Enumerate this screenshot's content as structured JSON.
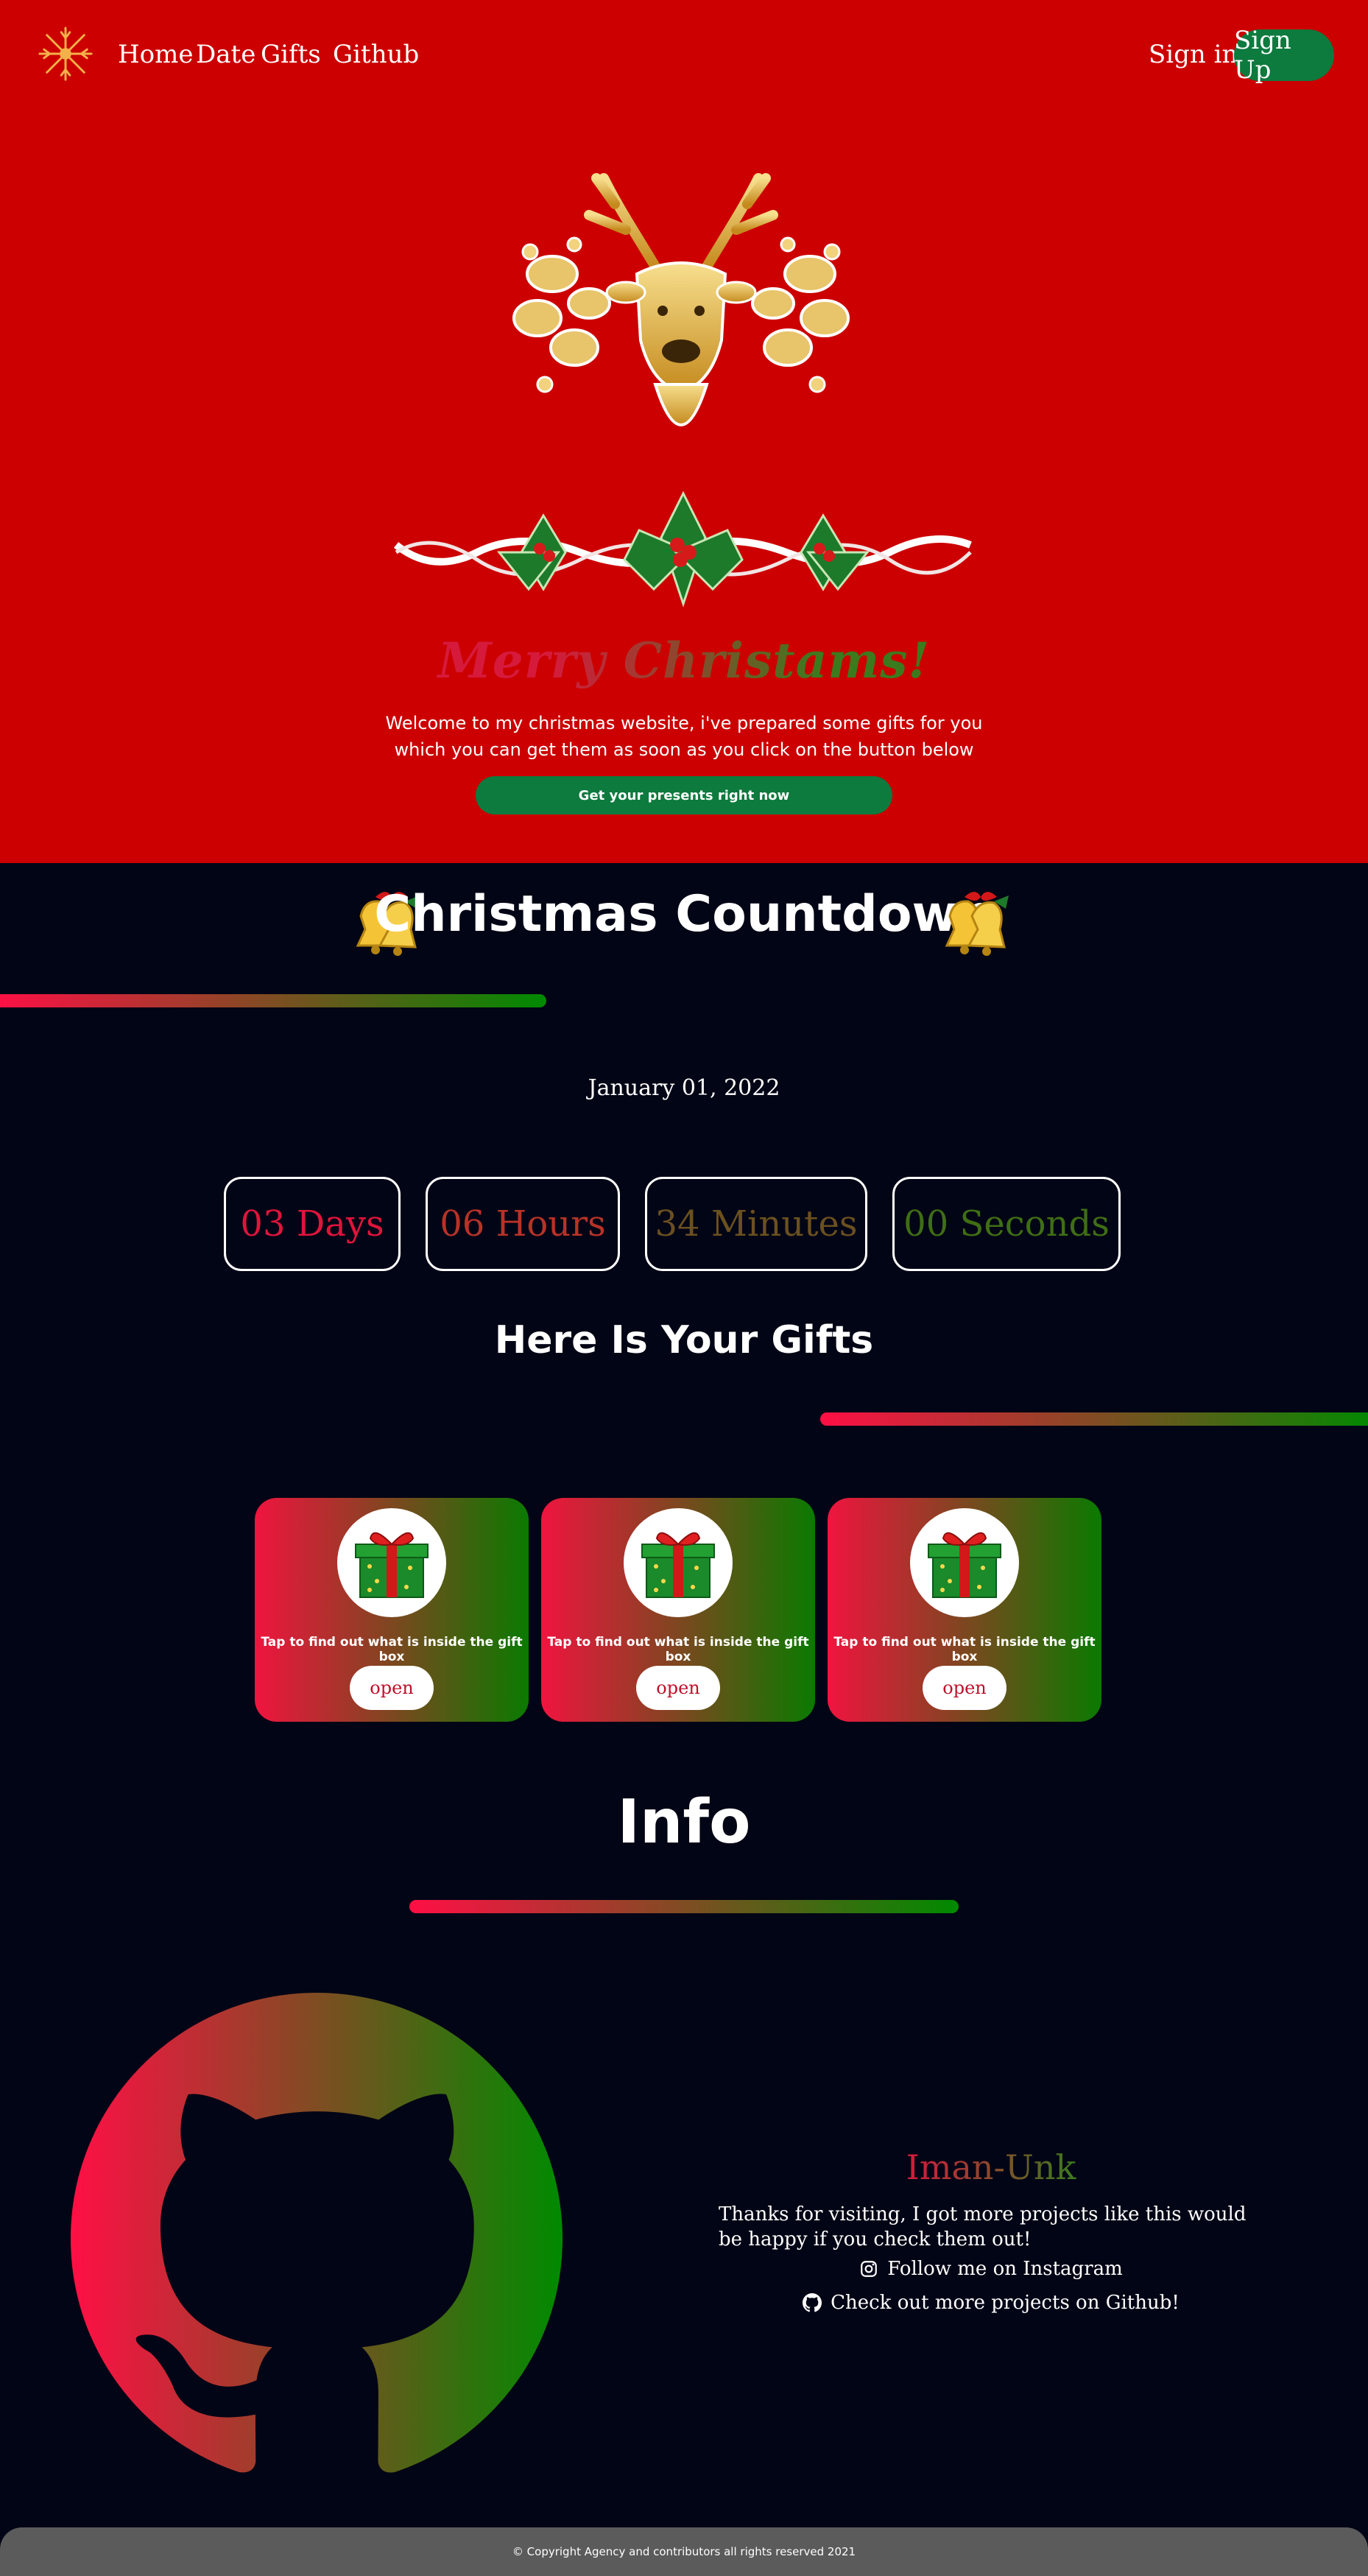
{
  "nav": {
    "links": [
      "Home",
      "Date",
      "Gifts",
      "Github"
    ],
    "sign_in": "Sign in",
    "sign_up": "Sign Up"
  },
  "hero": {
    "title": "Merry Christams!",
    "welcome": "Welcome to my christmas website, i've prepared some gifts for you which you can get them as soon as you click on the button below",
    "button": "Get your presents right now"
  },
  "countdown": {
    "title": "Christmas Countdown",
    "date": "January 01, 2022",
    "units": [
      {
        "label": "03 Days",
        "color": "#e0143c"
      },
      {
        "label": "06 Hours",
        "color": "#b83227"
      },
      {
        "label": "34 Minutes",
        "color": "#6b5020"
      },
      {
        "label": "00 Seconds",
        "color": "#3f6e14"
      }
    ]
  },
  "gifts": {
    "title": "Here Is Your Gifts",
    "cards": [
      {
        "text": "Tap to find out what is inside the gift box",
        "button": "open"
      },
      {
        "text": "Tap to find out what is inside the gift box",
        "button": "open"
      },
      {
        "text": "Tap to find out what is inside the gift box",
        "button": "open"
      }
    ]
  },
  "info": {
    "title": "Info",
    "name": "Iman-Unk",
    "text": "Thanks for visiting, I got more projects like this would be happy if you check them out!",
    "instagram": "Follow me on Instagram",
    "github": "Check out more projects on Github!"
  },
  "footer": {
    "copyright": "© Copyright Agency and contributors all rights reserved 2021"
  },
  "colors": {
    "hero_red": "#cc0000",
    "green_button": "#0d7a3e",
    "page_bg": "#020515",
    "gradient_start": "#ff0f45",
    "gradient_end": "#008a00"
  }
}
